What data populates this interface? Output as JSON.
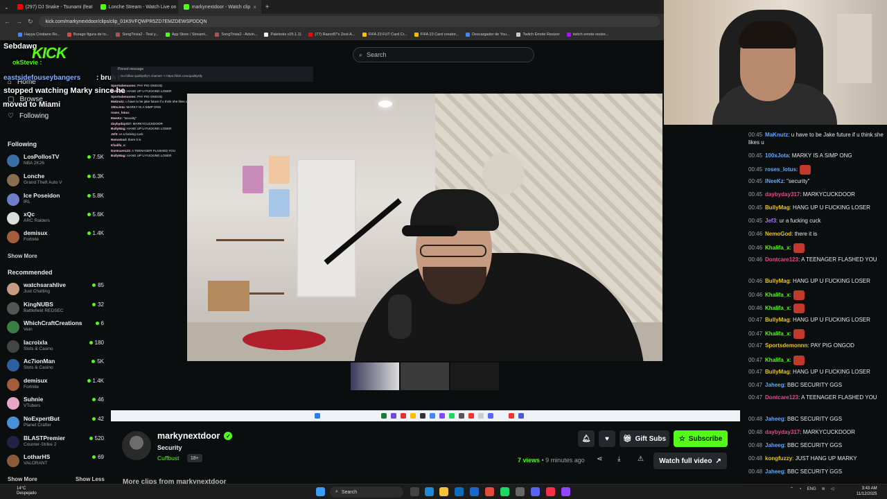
{
  "browser": {
    "tabs": [
      {
        "title": "(297) DJ Snake - Tsunami (feat",
        "color": "#ff0000"
      },
      {
        "title": "Lonche Stream - Watch Live on",
        "color": "#53fc18"
      },
      {
        "title": "markynextdoor - Watch clip",
        "color": "#53fc18"
      }
    ],
    "url": "kick.com/markynextdoor/clips/clip_01K9VFQWPR5ZD7EMZDEWSPDDQN",
    "bookmarks": [
      "Hayya Cristiano Ro...",
      "Burago figura de to...",
      "SongTrivia2 - Test y...",
      "App Store / Streami...",
      "SongTrivia2 - Advin...",
      "Paletools v25.1.11",
      "(77) Razor87's Zest-A...",
      "FIFA 23 FUT Card Cr...",
      "FIFA 23 Card creator...",
      "Descargador de You...",
      "Twitch Emote Resizer",
      "twitch emote resize..."
    ]
  },
  "search": {
    "placeholder": "Search"
  },
  "overlay": {
    "user1": "Sebdawg",
    "user2": "okStevie :",
    "user3": "eastsidefouseybangers",
    "msg3a": ": bruh I",
    "msg3b": "stopped watching Marky since he",
    "msg3c": "moved to Miami",
    "kick": "KICK"
  },
  "minichat": {
    "pinned": "Pinned message",
    "pinned_msg": "Go follow qualityslly's channel -> https://kick.com/qualityslly",
    "lines": [
      {
        "u": "Sportsdemonnn:",
        "m": "PAY PIG ONGOD"
      },
      {
        "u": "BullyMag:",
        "m": "HANG UP U FUCKING LOSER"
      },
      {
        "u": "Sportsdemonnn:",
        "m": "PAY PIG ONGOD"
      },
      {
        "u": "Maknutz:",
        "m": "u have to be jake future if u think she likes u"
      },
      {
        "u": "100xJota:",
        "m": "MARKY IS A SIMP ONG"
      },
      {
        "u": "roses_lotus:",
        "m": ""
      },
      {
        "u": "INeeKz:",
        "m": "\"security\""
      },
      {
        "u": "daybyday317:",
        "m": "MARKYCUCKDOOR"
      },
      {
        "u": "BullyMag:",
        "m": "HANG UP U FUCKING LOSER"
      },
      {
        "u": "Jef3:",
        "m": "ur a fucking cuck"
      },
      {
        "u": "NemoGod:",
        "m": "there it is"
      },
      {
        "u": "Khalifa_x:",
        "m": ""
      },
      {
        "u": "Dontcare123:",
        "m": "A TEENAGER FLASHED YOU"
      },
      {
        "u": "BullyMag:",
        "m": "HANG UP U FUCKING LOSER"
      }
    ]
  },
  "sidebar": {
    "home": "Home",
    "browse": "Browse",
    "following_link": "Following",
    "following_head": "Following",
    "following": [
      {
        "name": "LosPollosTV",
        "game": "NBA 2K26",
        "viewers": "7.5K",
        "color": "#3b6ea5"
      },
      {
        "name": "Lonche",
        "game": "Grand Theft Auto V",
        "viewers": "6.3K",
        "color": "#8a6d4f"
      },
      {
        "name": "Ice Poseidon",
        "game": "IRL",
        "viewers": "5.8K",
        "color": "#6f7ec9"
      },
      {
        "name": "xQc",
        "game": "ARC Raiders",
        "viewers": "5.6K",
        "color": "#dddddd"
      },
      {
        "name": "demisux",
        "game": "Fortnite",
        "viewers": "1.4K",
        "color": "#a35d3c"
      }
    ],
    "show_more_1": "Show More",
    "recommended_head": "Recommended",
    "recommended": [
      {
        "name": "watchsarahlive",
        "game": "Just Chatting",
        "viewers": "85",
        "color": "#c79b82"
      },
      {
        "name": "KingNUBS",
        "game": "Battlefield REDSEC",
        "viewers": "32",
        "color": "#555555"
      },
      {
        "name": "WhichCraftCreations",
        "game": "Vein",
        "viewers": "6",
        "color": "#3a7d44"
      },
      {
        "name": "lacroixla",
        "game": "Slots & Casino",
        "viewers": "180",
        "color": "#444444"
      },
      {
        "name": "Ac7ionMan",
        "game": "Slots & Casino",
        "viewers": "5K",
        "color": "#2f5e9e"
      },
      {
        "name": "demisux",
        "game": "Fortnite",
        "viewers": "1.4K",
        "color": "#a35d3c"
      },
      {
        "name": "Suhnie",
        "game": "VTubers",
        "viewers": "46",
        "color": "#e8a6c8"
      },
      {
        "name": "NoExpertBut",
        "game": "Planet Crafter",
        "viewers": "42",
        "color": "#4a90d9"
      },
      {
        "name": "BLASTPremier",
        "game": "Counter-Strike 2",
        "viewers": "520",
        "color": "#222244"
      },
      {
        "name": "LotharHS",
        "game": "VALORANT",
        "viewers": "69",
        "color": "#8a5b3a"
      }
    ],
    "show_more_2": "Show More",
    "show_less": "Show Less"
  },
  "channel": {
    "name": "markynextdoor",
    "title": "Security",
    "category": "Cuffbust",
    "age": "18+",
    "gift_subs": "Gift Subs",
    "subscribe": "Subscribe",
    "views": "7 views",
    "ago": " • 9 minutes ago",
    "watch_full": "Watch full video",
    "more_clips": "More clips from markynextdoor"
  },
  "chat": [
    {
      "time": "00:45",
      "user": "MaKnutz",
      "color": "#5fa8ff",
      "text": ": u have to be Jake future if u think she likes u"
    },
    {
      "time": "00:45",
      "user": "100xJota",
      "color": "#5fa8ff",
      "text": ": MARKY IS A SIMP ONG"
    },
    {
      "time": "00:45",
      "user": "roses_lotus",
      "color": "#5fa8ff",
      "text": ":"
    },
    {
      "time": "00:45",
      "user": "INeeKz",
      "color": "#5fa8ff",
      "text": ": \"security\""
    },
    {
      "time": "00:45",
      "user": "daybyday317",
      "color": "#e24a8d",
      "text": ": MARKYCUCKDOOR"
    },
    {
      "time": "00:45",
      "user": "BullyMag",
      "color": "#e9c31a",
      "text": ": HANG UP U FUCKING LOSER"
    },
    {
      "time": "00:45",
      "user": "Jef3",
      "color": "#a879ff",
      "text": ": ur a fucking cuck"
    },
    {
      "time": "00:46",
      "user": "NemoGod",
      "color": "#e9c31a",
      "text": ": there it is"
    },
    {
      "time": "00:46",
      "user": "Khalifa_x",
      "color": "#53fc18",
      "text": ":"
    },
    {
      "time": "00:46",
      "user": "Dontcare123",
      "color": "#e24a8d",
      "text": ": A TEENAGER FLASHED YOU"
    },
    {
      "time": "00:46",
      "user": "BullyMag",
      "color": "#e9c31a",
      "text": ": HANG UP U FUCKING LOSER"
    },
    {
      "time": "00:46",
      "user": "Khalifa_x",
      "color": "#53fc18",
      "text": ":"
    },
    {
      "time": "00:46",
      "user": "Khalifa_x",
      "color": "#53fc18",
      "text": ":"
    },
    {
      "time": "00:47",
      "user": "BullyMag",
      "color": "#e9c31a",
      "text": ": HANG UP U FUCKING LOSER"
    },
    {
      "time": "00:47",
      "user": "Khalifa_x",
      "color": "#53fc18",
      "text": ":"
    },
    {
      "time": "00:47",
      "user": "Sportsdemonnn",
      "color": "#e9c31a",
      "text": ": PAY PIG ONGOD"
    },
    {
      "time": "00:47",
      "user": "Khalifa_x",
      "color": "#53fc18",
      "text": ":"
    },
    {
      "time": "00:47",
      "user": "BullyMag",
      "color": "#e9c31a",
      "text": ": HANG UP U FUCKING LOSER"
    },
    {
      "time": "00:47",
      "user": "Jaheeg",
      "color": "#5fa8ff",
      "text": ": BBC SECURITY GGS"
    },
    {
      "time": "00:47",
      "user": "Dontcare123",
      "color": "#e24a8d",
      "text": ": A TEENAGER FLASHED YOU"
    },
    {
      "time": "00:48",
      "user": "Jaheeg",
      "color": "#5fa8ff",
      "text": ": BBC SECURITY GGS"
    },
    {
      "time": "00:48",
      "user": "daybyday317",
      "color": "#e24a8d",
      "text": ": MARKYCUCKDOOR"
    },
    {
      "time": "00:48",
      "user": "Jaheeg",
      "color": "#5fa8ff",
      "text": ": BBC SECURITY GGS"
    },
    {
      "time": "00:48",
      "user": "kongfuzzy",
      "color": "#e9c31a",
      "text": ": JUST HANG UP MARKY"
    },
    {
      "time": "00:48",
      "user": "Jaheeg",
      "color": "#5fa8ff",
      "text": ": BBC SECURITY GGS"
    }
  ],
  "taskbar": {
    "temp": "14°C",
    "weather": "Despejado",
    "search": "Search",
    "lang": "ENG",
    "time": "3:43 AM",
    "date": "11/12/2025"
  }
}
